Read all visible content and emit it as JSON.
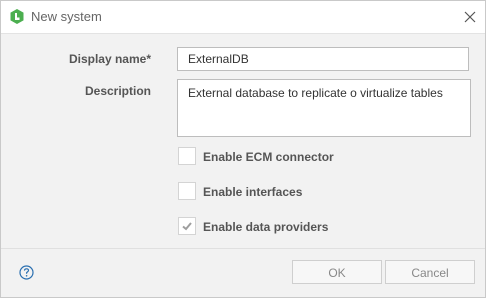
{
  "window": {
    "title": "New system"
  },
  "form": {
    "display_name_label": "Display name*",
    "display_name_value": "ExternalDB",
    "description_label": "Description",
    "description_value": "External database to replicate o virtualize tables"
  },
  "options": [
    {
      "label": "Enable ECM connector",
      "checked": false
    },
    {
      "label": "Enable interfaces",
      "checked": false
    },
    {
      "label": "Enable data providers",
      "checked": true
    }
  ],
  "footer": {
    "ok_label": "OK",
    "cancel_label": "Cancel"
  },
  "colors": {
    "brand_green": "#4caf50",
    "help_blue": "#2a6fb0"
  }
}
